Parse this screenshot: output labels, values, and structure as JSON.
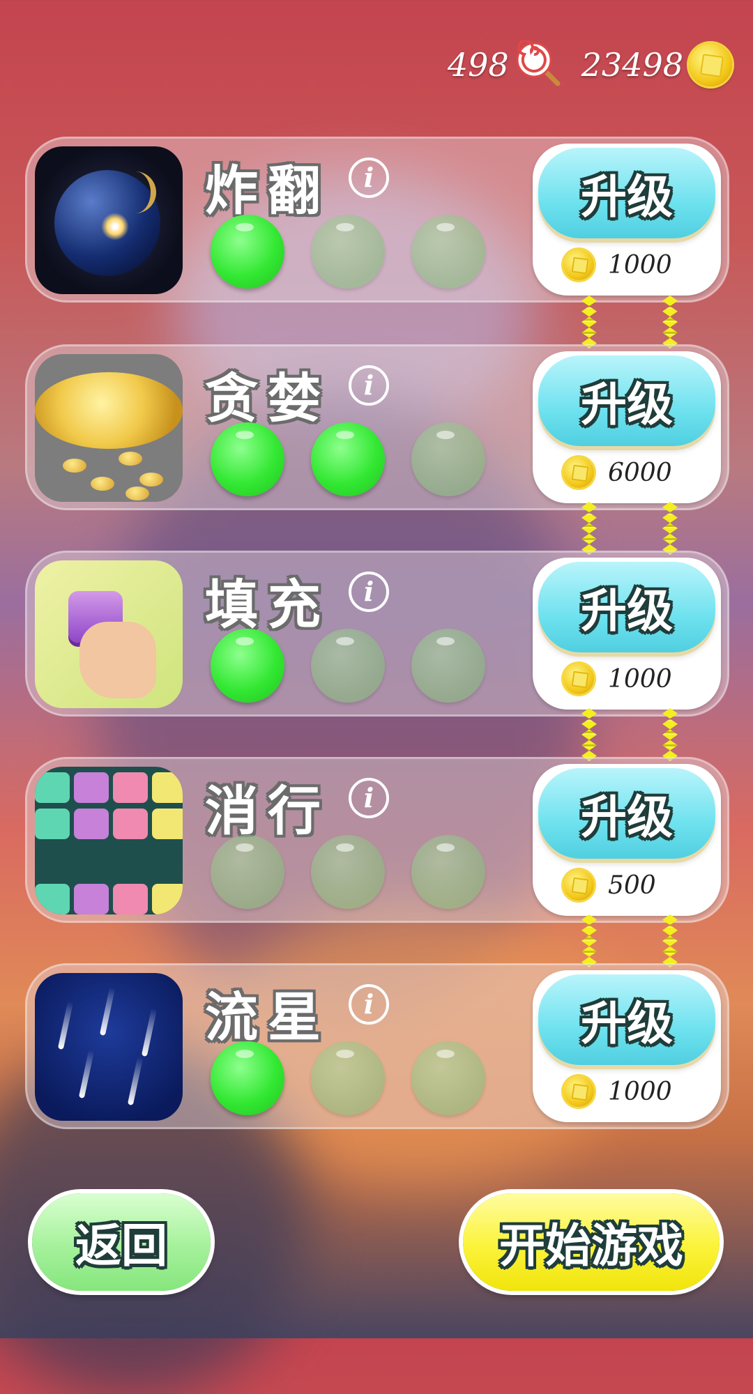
{
  "currency": {
    "candy": "498",
    "coins": "23498"
  },
  "upgrade_label": "升级",
  "info_glyph": "i",
  "skills": [
    {
      "name": "炸翻",
      "level": 1,
      "max_level": 3,
      "price": "1000",
      "image": "bomb"
    },
    {
      "name": "贪婪",
      "level": 2,
      "max_level": 3,
      "price": "6000",
      "image": "gold-coins"
    },
    {
      "name": "填充",
      "level": 1,
      "max_level": 3,
      "price": "1000",
      "image": "fill-block"
    },
    {
      "name": "消行",
      "level": 0,
      "max_level": 3,
      "price": "500",
      "image": "clear-row"
    },
    {
      "name": "流星",
      "level": 1,
      "max_level": 3,
      "price": "1000",
      "image": "meteor"
    }
  ],
  "buttons": {
    "back": "返回",
    "start": "开始游戏"
  },
  "colors": {
    "level_on": "#33e833",
    "upgrade_button": "#6fe2ef",
    "back_button": "#a5f19b",
    "start_button": "#fbf33a"
  }
}
